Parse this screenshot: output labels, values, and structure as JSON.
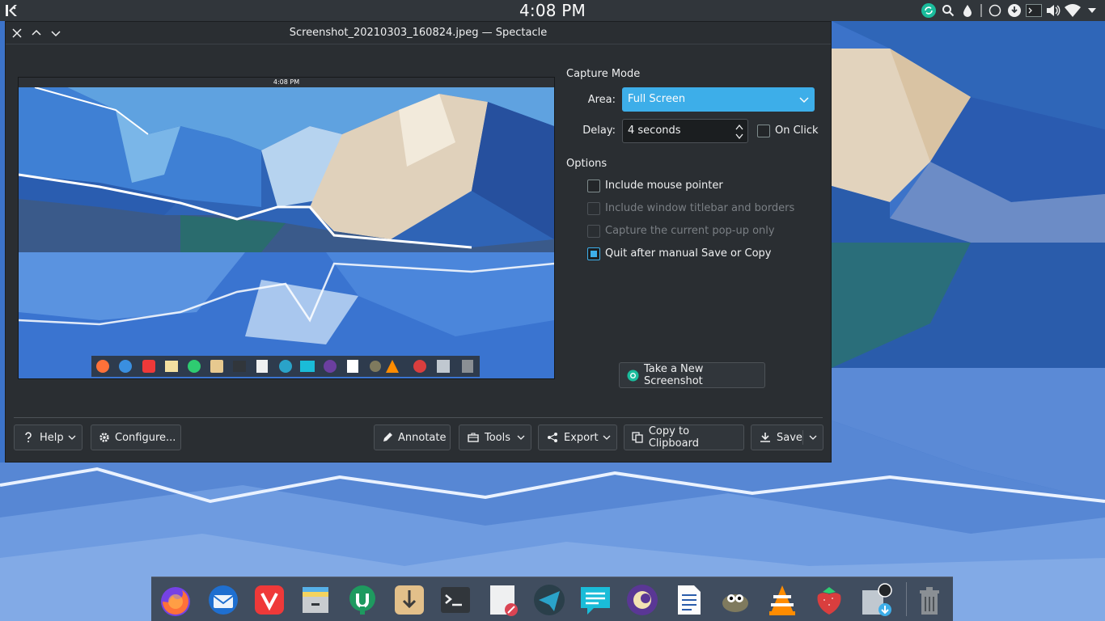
{
  "top_panel": {
    "clock": "4:08 PM",
    "tray_icons": [
      "sync-icon",
      "search-icon",
      "drop-icon",
      "separator",
      "circle-icon",
      "download-icon",
      "terminal-icon",
      "volume-icon",
      "wifi-icon",
      "chevron-down-icon"
    ]
  },
  "window": {
    "title": "Screenshot_20210303_160824.jpeg — Spectacle",
    "preview": {
      "clock": "4:08 PM"
    },
    "capture_mode": {
      "heading": "Capture Mode",
      "area_label": "Area:",
      "area_value": "Full Screen",
      "delay_label": "Delay:",
      "delay_value": "4 seconds",
      "on_click_label": "On Click",
      "on_click_checked": false
    },
    "options": {
      "heading": "Options",
      "items": [
        {
          "label": "Include mouse pointer",
          "checked": false,
          "enabled": true
        },
        {
          "label": "Include window titlebar and borders",
          "checked": false,
          "enabled": false
        },
        {
          "label": "Capture the current pop-up only",
          "checked": false,
          "enabled": false
        },
        {
          "label": "Quit after manual Save or Copy",
          "checked": true,
          "enabled": true
        }
      ]
    },
    "take_screenshot_label": "Take a New Screenshot",
    "bottom_buttons": {
      "help": "Help",
      "configure": "Configure...",
      "annotate": "Annotate",
      "tools": "Tools",
      "export": "Export",
      "copy": "Copy to Clipboard",
      "save": "Save"
    }
  },
  "dock": {
    "apps": [
      "firefox-icon",
      "thunderbird-icon",
      "vivaldi-icon",
      "file-manager-icon",
      "mintstick-icon",
      "installer-icon",
      "terminal-icon",
      "text-editor-icon",
      "telegram-icon",
      "chat-icon",
      "elisa-icon",
      "writer-icon",
      "gimp-icon",
      "vlc-icon",
      "strawberry-icon",
      "spectacle-icon",
      "trash-icon"
    ]
  }
}
